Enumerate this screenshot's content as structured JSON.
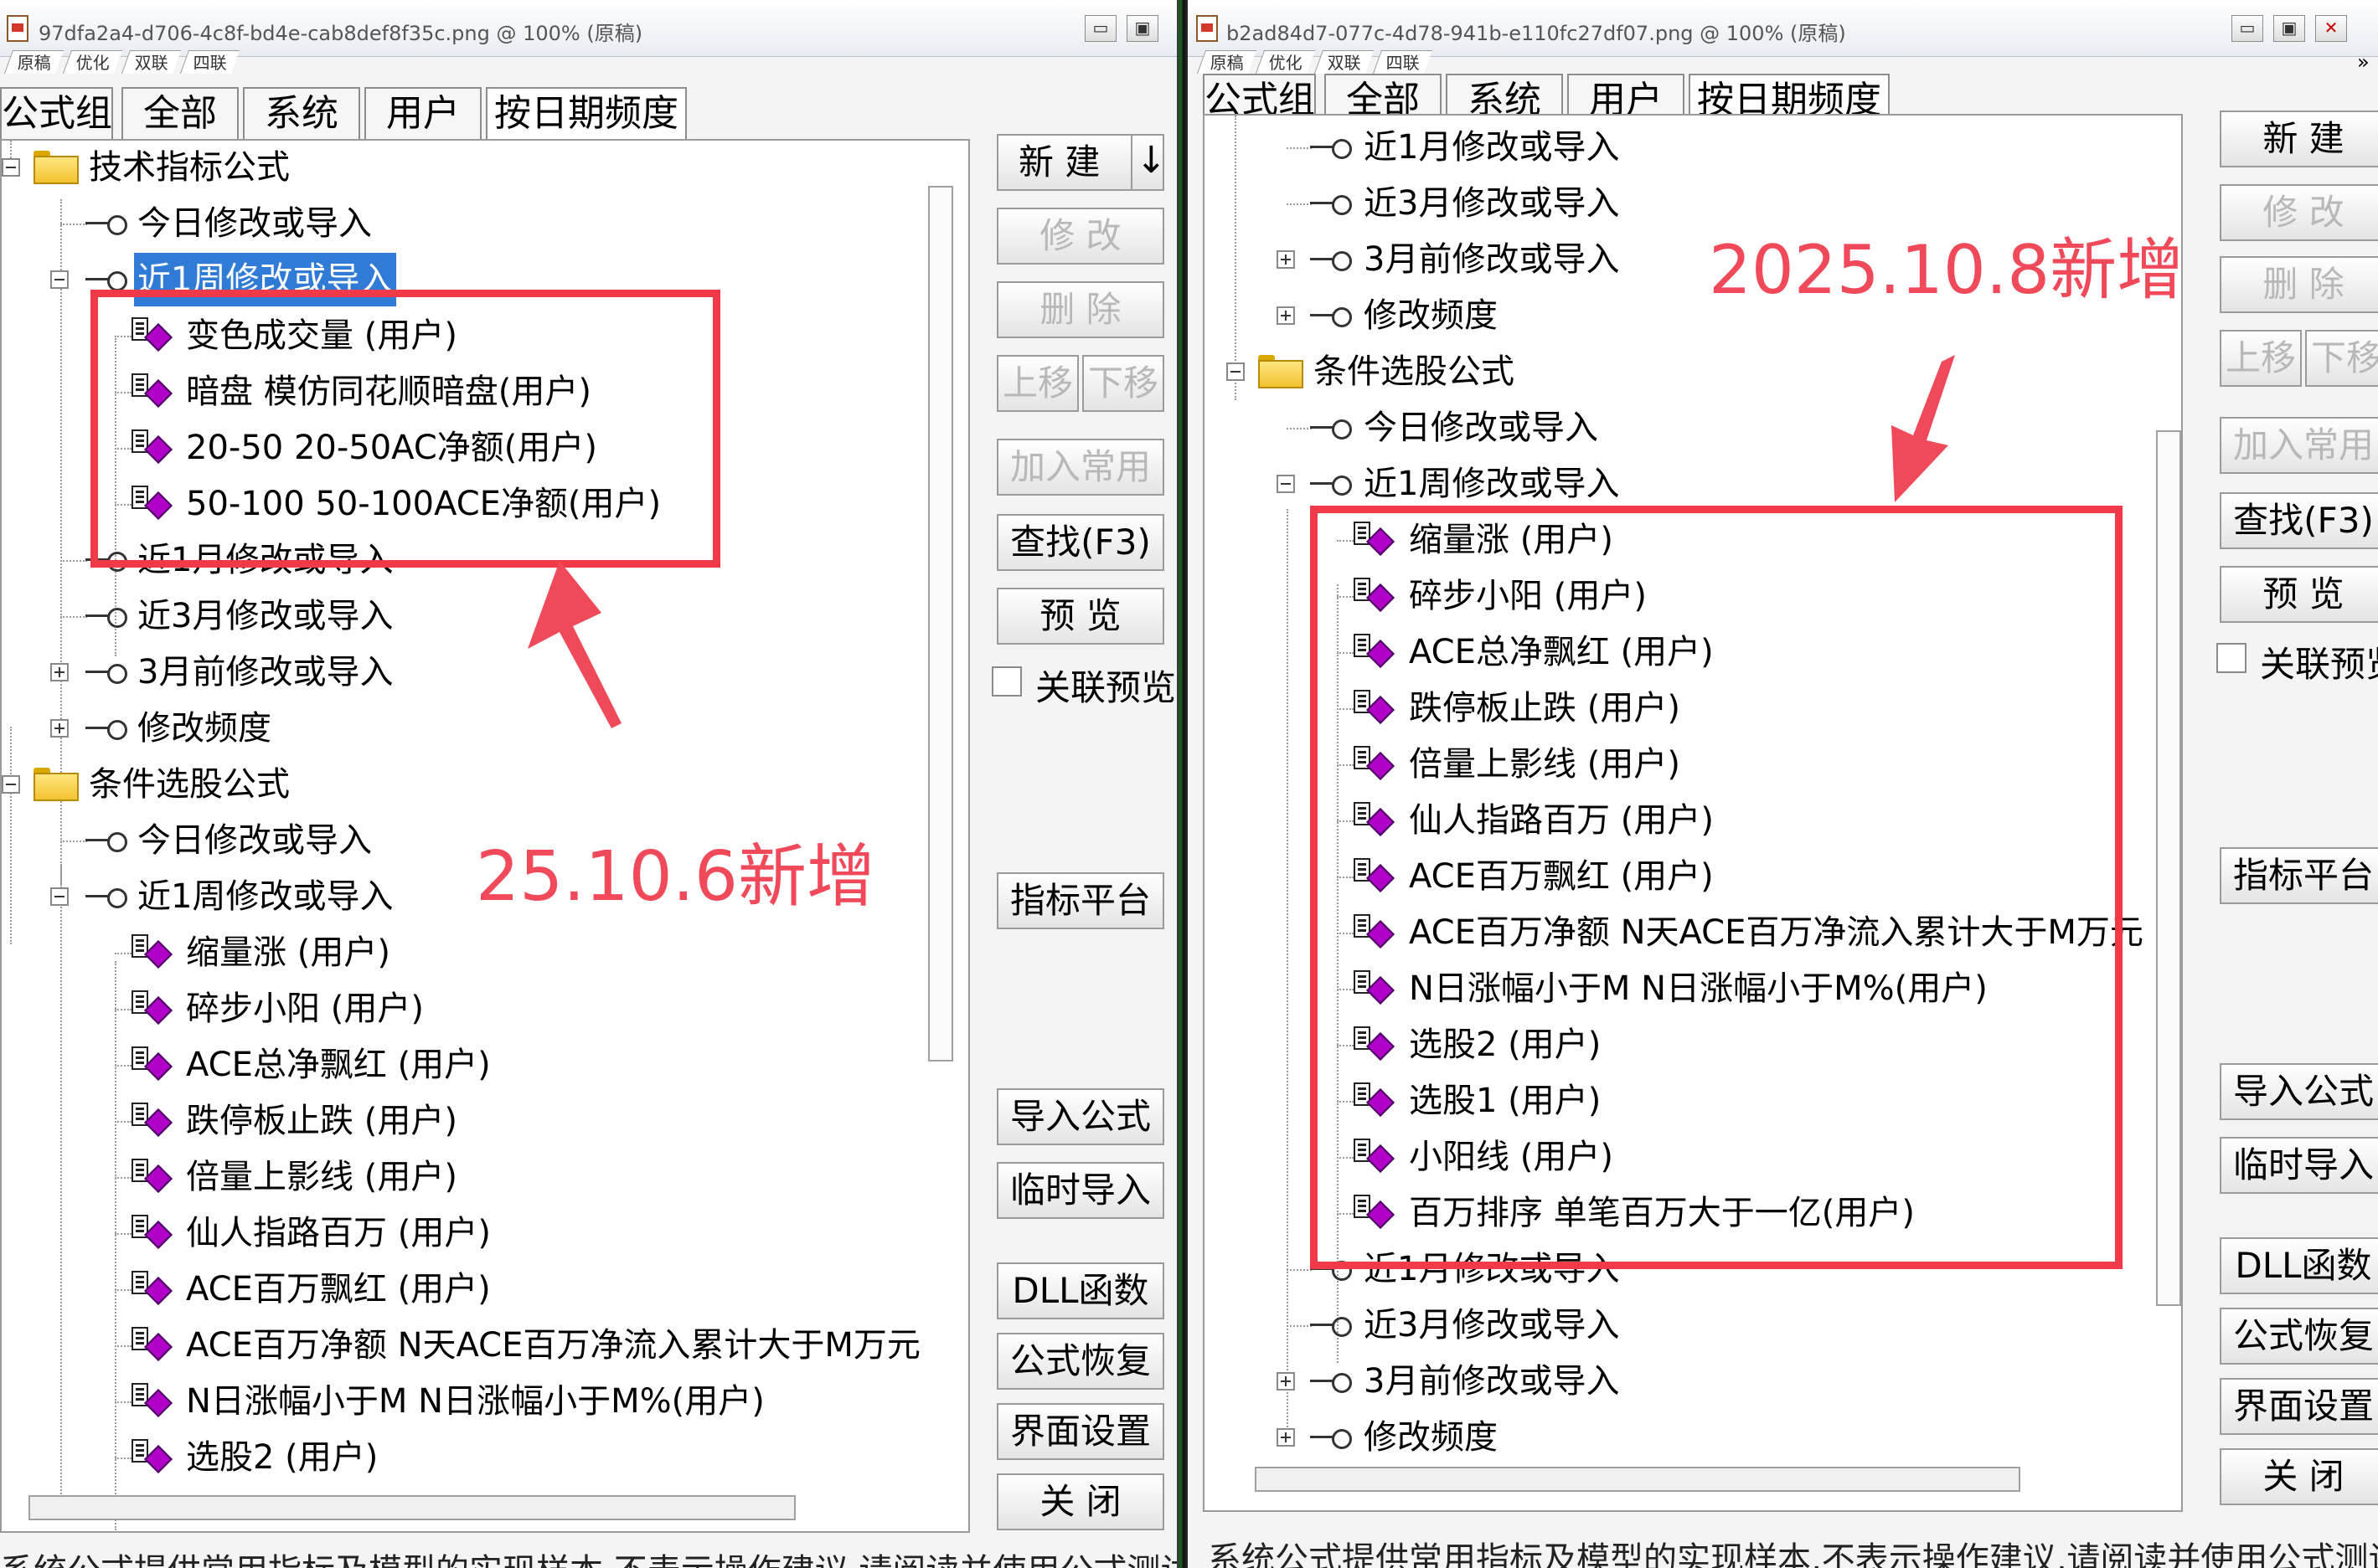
{
  "left": {
    "title": "97dfa2a4-d706-4c8f-bd4e-cab8def8f35c.png @ 100% (原稿)",
    "mode_tabs": [
      "原稿",
      "优化",
      "双联",
      "四联"
    ],
    "category_tabs": [
      "公式组",
      "全部",
      "系统",
      "用户",
      "按日期频度"
    ],
    "tree": [
      "技术指标公式",
      "今日修改或导入",
      "近1周修改或导入",
      "变色成交量  (用户)",
      "暗盘  模仿同花顺暗盘(用户)",
      "20-50  20-50AC净额(用户)",
      "50-100  50-100ACE净额(用户)",
      "近1月修改或导入",
      "近3月修改或导入",
      "3月前修改或导入",
      "修改频度",
      "条件选股公式",
      "今日修改或导入",
      "近1周修改或导入",
      "缩量涨  (用户)",
      "碎步小阳  (用户)",
      "ACE总净飘红  (用户)",
      "跌停板止跌  (用户)",
      "倍量上影线  (用户)",
      "仙人指路百万  (用户)",
      "ACE百万飘红  (用户)",
      "ACE百万净额  N天ACE百万净流入累计大于M万元",
      "N日涨幅小于M  N日涨幅小于M%(用户)",
      "选股2  (用户)"
    ],
    "buttons": {
      "new": "新  建",
      "new_arrow": "↓",
      "modify": "修  改",
      "delete": "删  除",
      "move_up": "上移",
      "move_down": "下移",
      "add_common": "加入常用",
      "find": "查找(F3)",
      "preview": "预  览",
      "link_preview": "关联预览",
      "indicator_platform": "指标平台",
      "import_formula": "导入公式",
      "temp_import": "临时导入",
      "dll": "DLL函数",
      "restore": "公式恢复",
      "ui_settings": "界面设置",
      "close": "关  闭"
    },
    "footer": "系统公式提供常用指标及模型的实现样本,不表示操作建议,请阅读并使用公式测试系",
    "annotation": "25.10.6新增"
  },
  "right": {
    "title": "b2ad84d7-077c-4d78-941b-e110fc27df07.png @ 100% (原稿)",
    "mode_tabs": [
      "原稿",
      "优化",
      "双联",
      "四联"
    ],
    "mode_overflow": "»",
    "category_tabs": [
      "公式组",
      "全部",
      "系统",
      "用户",
      "按日期频度"
    ],
    "tree": [
      "近1月修改或导入",
      "近3月修改或导入",
      "3月前修改或导入",
      "修改频度",
      "条件选股公式",
      "今日修改或导入",
      "近1周修改或导入",
      "缩量涨  (用户)",
      "碎步小阳  (用户)",
      "ACE总净飘红  (用户)",
      "跌停板止跌  (用户)",
      "倍量上影线  (用户)",
      "仙人指路百万  (用户)",
      "ACE百万飘红  (用户)",
      "ACE百万净额  N天ACE百万净流入累计大于M万元",
      "N日涨幅小于M  N日涨幅小于M%(用户)",
      "选股2  (用户)",
      "选股1  (用户)",
      "小阳线  (用户)",
      "百万排序  单笔百万大于一亿(用户)",
      "近1月修改或导入",
      "近3月修改或导入",
      "3月前修改或导入",
      "修改频度"
    ],
    "buttons": {
      "new": "新  建",
      "modify": "修  改",
      "delete": "删  除",
      "move_up": "上移",
      "move_down": "下移",
      "add_common": "加入常用",
      "find": "查找(F3)",
      "preview": "预  览",
      "link_preview": "关联预览",
      "indicator_platform": "指标平台",
      "import_formula": "导入公式",
      "temp_import": "临时导入",
      "dll": "DLL函数",
      "restore": "公式恢复",
      "ui_settings": "界面设置",
      "close": "关  闭"
    },
    "footer": "系统公式提供常用指标及模型的实现样本,不表示操作建议,请阅读并使用公式测试系统",
    "annotation": "2025.10.8新增"
  },
  "colors": {
    "selection": "#2f7bd6",
    "annotation_red": "#f0495a",
    "highlight_box": "#f03a49"
  }
}
